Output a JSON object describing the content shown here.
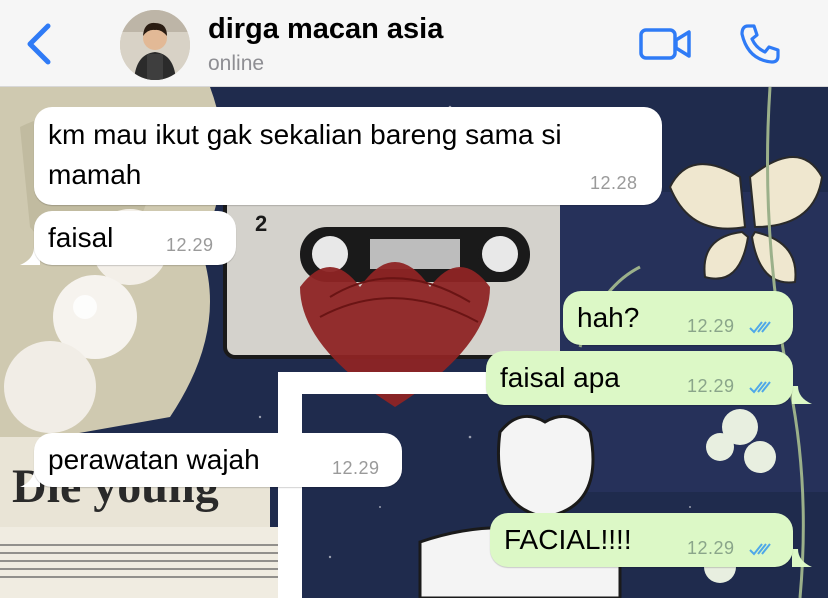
{
  "header": {
    "contact_name": "dirga macan asia",
    "status": "online",
    "back_icon": "chevron-left-icon",
    "video_icon": "video-camera-icon",
    "call_icon": "phone-icon",
    "accent_color": "#2f7bf6"
  },
  "messages": [
    {
      "direction": "incoming",
      "text_lines": [
        "km mau ikut gak sekalian bareng sama si",
        "mamah"
      ],
      "time": "12.28"
    },
    {
      "direction": "incoming",
      "text": "faisal",
      "time": "12.29"
    },
    {
      "direction": "outgoing",
      "text": "hah?",
      "time": "12.29",
      "status": "read"
    },
    {
      "direction": "outgoing",
      "text": "faisal apa",
      "time": "12.29",
      "status": "read"
    },
    {
      "direction": "incoming",
      "text": "perawatan wajah",
      "time": "12.29"
    },
    {
      "direction": "outgoing",
      "text": "FACIAL!!!!",
      "time": "12.29",
      "status": "read"
    }
  ],
  "colors": {
    "incoming_bubble": "#ffffff",
    "outgoing_bubble": "#dcf8c6",
    "read_ticks": "#4fa8e8"
  }
}
